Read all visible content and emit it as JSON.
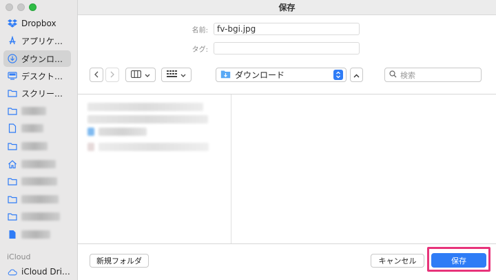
{
  "window": {
    "title": "保存"
  },
  "sidebar": {
    "items": [
      {
        "label": "Dropbox",
        "icon": "dropbox-icon"
      },
      {
        "label": "アプリケ…",
        "icon": "applications-icon"
      },
      {
        "label": "ダウンロ…",
        "icon": "download-icon",
        "selected": true
      },
      {
        "label": "デスクト…",
        "icon": "desktop-icon"
      },
      {
        "label": "スクリー…",
        "icon": "folder-icon"
      }
    ],
    "section_icloud": "iCloud",
    "icloud_item": "iCloud Dri…"
  },
  "form": {
    "name_label": "名前:",
    "name_value": "fv-bgi.jpg",
    "tag_label": "タグ:",
    "tag_value": ""
  },
  "toolbar": {
    "location": "ダウンロード",
    "search_placeholder": "検索"
  },
  "buttons": {
    "new_folder": "新規フォルダ",
    "cancel": "キャンセル",
    "save": "保存"
  },
  "colors": {
    "accent": "#2f7cf6",
    "highlight_border": "#e7337a",
    "sidebar_bg": "#e9e8e8"
  }
}
